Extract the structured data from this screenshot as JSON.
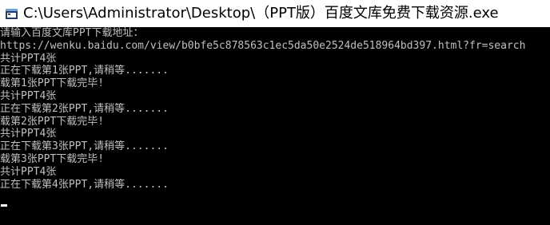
{
  "window": {
    "title": "C:\\Users\\Administrator\\Desktop\\（PPT版）百度文库免费下载资源.exe",
    "icon": "console-app-icon"
  },
  "console": {
    "colors": {
      "background": "#000000",
      "text": "#c0c0c0",
      "cursor": "#ffffff"
    },
    "lines": [
      "请输入百度文库PPT下载地址：",
      "https://wenku.baidu.com/view/b0bfe5c878563c1ec5da50e2524de518964bd397.html?fr=search",
      "共计PPT4张",
      "正在下载第1张PPT,请稍等.......",
      "载第1张PPT下载完毕!",
      "共计PPT4张",
      "正在下载第2张PPT,请稍等.......",
      "载第2张PPT下载完毕!",
      "共计PPT4张",
      "正在下载第3张PPT,请稍等.......",
      "载第3张PPT下载完毕!",
      "共计PPT4张",
      "正在下载第4张PPT,请稍等......."
    ]
  }
}
